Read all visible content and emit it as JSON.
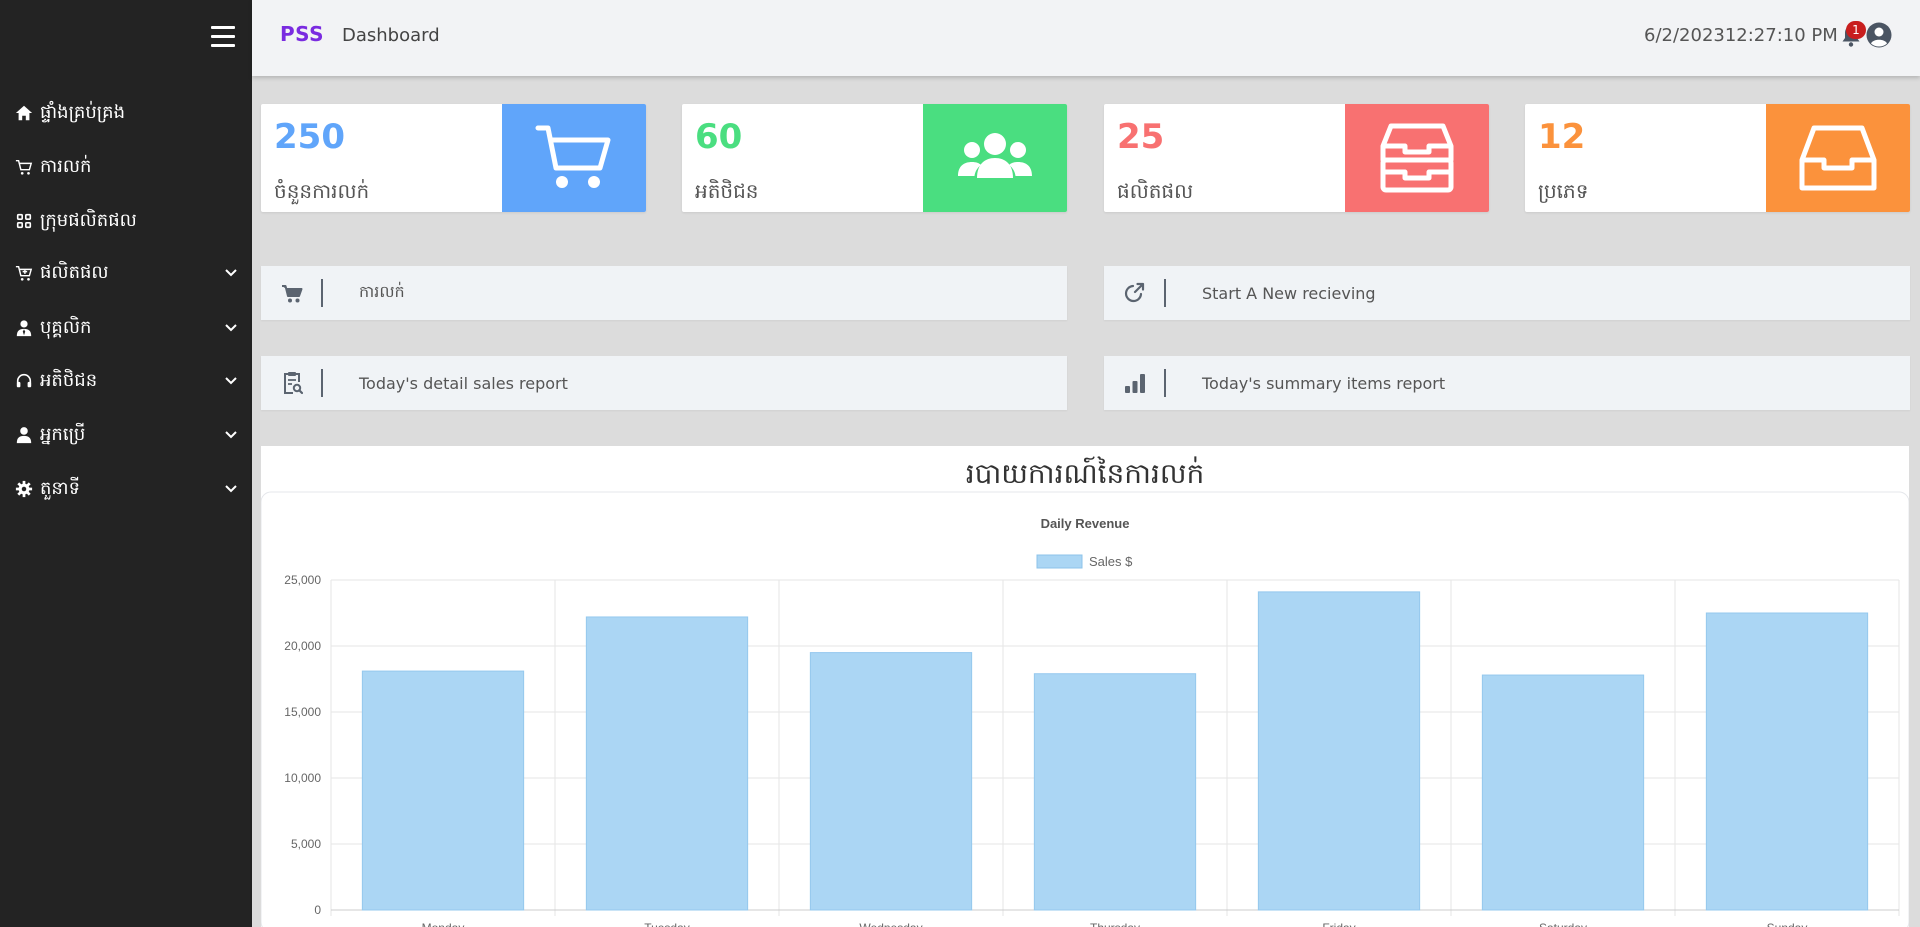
{
  "app": {
    "brand": "PSS",
    "page_title": "Dashboard",
    "datetime": "6/2/202312:27:10 PM",
    "notification_count": "1"
  },
  "sidebar": {
    "items": [
      {
        "label": "ផ្ទាំងគ្រប់គ្រង",
        "icon": "home-icon",
        "expandable": false
      },
      {
        "label": "ការលក់",
        "icon": "cart-icon",
        "expandable": false
      },
      {
        "label": "ក្រុមផលិតផល",
        "icon": "grid-icon",
        "expandable": false
      },
      {
        "label": "ផលិតផល",
        "icon": "cart-plus-icon",
        "expandable": true
      },
      {
        "label": "បុគ្គលិក",
        "icon": "user-tie-icon",
        "expandable": true
      },
      {
        "label": "អតិថិជន",
        "icon": "headset-icon",
        "expandable": true
      },
      {
        "label": "អ្នកប្រើ",
        "icon": "user-icon",
        "expandable": true
      },
      {
        "label": "តួនាទី",
        "icon": "gear-icon",
        "expandable": true
      }
    ]
  },
  "stats": [
    {
      "value": "250",
      "label": "ចំនួនការលក់",
      "color": "#60a5fa",
      "icon": "cart-icon"
    },
    {
      "value": "60",
      "label": "អតិថិជន",
      "color": "#4ade80",
      "icon": "users-icon"
    },
    {
      "value": "25",
      "label": "ផលិតផល",
      "color": "#f87171",
      "icon": "archive-icon"
    },
    {
      "value": "12",
      "label": "ប្រភេទ",
      "color": "#fb923c",
      "icon": "inbox-icon"
    }
  ],
  "actions": [
    {
      "label": "ការលក់",
      "icon": "cart-icon"
    },
    {
      "label": "Start A New recieving",
      "icon": "external-link-icon"
    },
    {
      "label": "Today's detail sales report",
      "icon": "clipboard-search-icon"
    },
    {
      "label": "Today's summary items report",
      "icon": "bar-chart-icon"
    }
  ],
  "chart_heading": "របាយការណ៍នៃការលក់",
  "chart_data": {
    "type": "bar",
    "title": "Daily Revenue",
    "categories": [
      "Monday",
      "Tuesday",
      "Wednesday",
      "Thursday",
      "Friday",
      "Saturday",
      "Sunday"
    ],
    "series": [
      {
        "name": "Sales $",
        "values": [
          18100,
          22200,
          19500,
          17900,
          24100,
          17800,
          22500
        ],
        "color": "#abd6f4"
      }
    ],
    "yticks": [
      "0",
      "5,000",
      "10,000",
      "15,000",
      "20,000",
      "25,000"
    ],
    "ylim": [
      0,
      25000
    ],
    "grid": true,
    "legend": "top"
  }
}
